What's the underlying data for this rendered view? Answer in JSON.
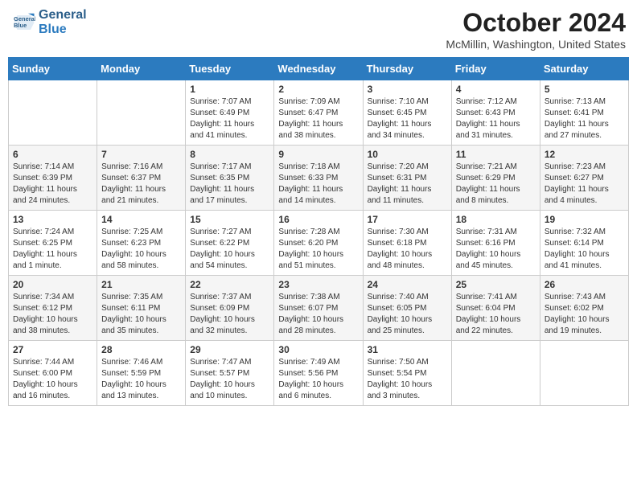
{
  "header": {
    "logo_line1": "General",
    "logo_line2": "Blue",
    "month": "October 2024",
    "location": "McMillin, Washington, United States"
  },
  "weekdays": [
    "Sunday",
    "Monday",
    "Tuesday",
    "Wednesday",
    "Thursday",
    "Friday",
    "Saturday"
  ],
  "weeks": [
    [
      {
        "day": "",
        "info": ""
      },
      {
        "day": "",
        "info": ""
      },
      {
        "day": "1",
        "info": "Sunrise: 7:07 AM\nSunset: 6:49 PM\nDaylight: 11 hours and 41 minutes."
      },
      {
        "day": "2",
        "info": "Sunrise: 7:09 AM\nSunset: 6:47 PM\nDaylight: 11 hours and 38 minutes."
      },
      {
        "day": "3",
        "info": "Sunrise: 7:10 AM\nSunset: 6:45 PM\nDaylight: 11 hours and 34 minutes."
      },
      {
        "day": "4",
        "info": "Sunrise: 7:12 AM\nSunset: 6:43 PM\nDaylight: 11 hours and 31 minutes."
      },
      {
        "day": "5",
        "info": "Sunrise: 7:13 AM\nSunset: 6:41 PM\nDaylight: 11 hours and 27 minutes."
      }
    ],
    [
      {
        "day": "6",
        "info": "Sunrise: 7:14 AM\nSunset: 6:39 PM\nDaylight: 11 hours and 24 minutes."
      },
      {
        "day": "7",
        "info": "Sunrise: 7:16 AM\nSunset: 6:37 PM\nDaylight: 11 hours and 21 minutes."
      },
      {
        "day": "8",
        "info": "Sunrise: 7:17 AM\nSunset: 6:35 PM\nDaylight: 11 hours and 17 minutes."
      },
      {
        "day": "9",
        "info": "Sunrise: 7:18 AM\nSunset: 6:33 PM\nDaylight: 11 hours and 14 minutes."
      },
      {
        "day": "10",
        "info": "Sunrise: 7:20 AM\nSunset: 6:31 PM\nDaylight: 11 hours and 11 minutes."
      },
      {
        "day": "11",
        "info": "Sunrise: 7:21 AM\nSunset: 6:29 PM\nDaylight: 11 hours and 8 minutes."
      },
      {
        "day": "12",
        "info": "Sunrise: 7:23 AM\nSunset: 6:27 PM\nDaylight: 11 hours and 4 minutes."
      }
    ],
    [
      {
        "day": "13",
        "info": "Sunrise: 7:24 AM\nSunset: 6:25 PM\nDaylight: 11 hours and 1 minute."
      },
      {
        "day": "14",
        "info": "Sunrise: 7:25 AM\nSunset: 6:23 PM\nDaylight: 10 hours and 58 minutes."
      },
      {
        "day": "15",
        "info": "Sunrise: 7:27 AM\nSunset: 6:22 PM\nDaylight: 10 hours and 54 minutes."
      },
      {
        "day": "16",
        "info": "Sunrise: 7:28 AM\nSunset: 6:20 PM\nDaylight: 10 hours and 51 minutes."
      },
      {
        "day": "17",
        "info": "Sunrise: 7:30 AM\nSunset: 6:18 PM\nDaylight: 10 hours and 48 minutes."
      },
      {
        "day": "18",
        "info": "Sunrise: 7:31 AM\nSunset: 6:16 PM\nDaylight: 10 hours and 45 minutes."
      },
      {
        "day": "19",
        "info": "Sunrise: 7:32 AM\nSunset: 6:14 PM\nDaylight: 10 hours and 41 minutes."
      }
    ],
    [
      {
        "day": "20",
        "info": "Sunrise: 7:34 AM\nSunset: 6:12 PM\nDaylight: 10 hours and 38 minutes."
      },
      {
        "day": "21",
        "info": "Sunrise: 7:35 AM\nSunset: 6:11 PM\nDaylight: 10 hours and 35 minutes."
      },
      {
        "day": "22",
        "info": "Sunrise: 7:37 AM\nSunset: 6:09 PM\nDaylight: 10 hours and 32 minutes."
      },
      {
        "day": "23",
        "info": "Sunrise: 7:38 AM\nSunset: 6:07 PM\nDaylight: 10 hours and 28 minutes."
      },
      {
        "day": "24",
        "info": "Sunrise: 7:40 AM\nSunset: 6:05 PM\nDaylight: 10 hours and 25 minutes."
      },
      {
        "day": "25",
        "info": "Sunrise: 7:41 AM\nSunset: 6:04 PM\nDaylight: 10 hours and 22 minutes."
      },
      {
        "day": "26",
        "info": "Sunrise: 7:43 AM\nSunset: 6:02 PM\nDaylight: 10 hours and 19 minutes."
      }
    ],
    [
      {
        "day": "27",
        "info": "Sunrise: 7:44 AM\nSunset: 6:00 PM\nDaylight: 10 hours and 16 minutes."
      },
      {
        "day": "28",
        "info": "Sunrise: 7:46 AM\nSunset: 5:59 PM\nDaylight: 10 hours and 13 minutes."
      },
      {
        "day": "29",
        "info": "Sunrise: 7:47 AM\nSunset: 5:57 PM\nDaylight: 10 hours and 10 minutes."
      },
      {
        "day": "30",
        "info": "Sunrise: 7:49 AM\nSunset: 5:56 PM\nDaylight: 10 hours and 6 minutes."
      },
      {
        "day": "31",
        "info": "Sunrise: 7:50 AM\nSunset: 5:54 PM\nDaylight: 10 hours and 3 minutes."
      },
      {
        "day": "",
        "info": ""
      },
      {
        "day": "",
        "info": ""
      }
    ]
  ]
}
